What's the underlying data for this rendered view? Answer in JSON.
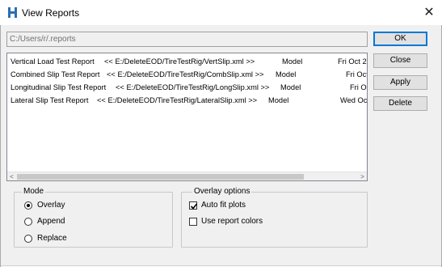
{
  "window": {
    "title": "View Reports",
    "close_glyph": "✕",
    "icon": "h-app-icon"
  },
  "path": {
    "value": "C:/Users/r/.reports"
  },
  "reports": [
    {
      "name": "Vertical Load Test Report",
      "path": "<< E:/DeleteEOD/TireTestRig/VertSlip.xml >>",
      "type": "Model",
      "date": "Fri Oct 29"
    },
    {
      "name": "Combined Slip Test Report",
      "path": "<< E:/DeleteEOD/TireTestRig/CombSlip.xml >>",
      "type": "Model",
      "date": "Fri Oct"
    },
    {
      "name": "Longitudinal Slip Test Report",
      "path": "<< E:/DeleteEOD/TireTestRig/LongSlip.xml >>",
      "type": "Model",
      "date": "Fri O"
    },
    {
      "name": "Lateral Slip Test Report",
      "path": "<< E:/DeleteEOD/TireTestRig/LateralSlip.xml >>",
      "type": "Model",
      "date": "Wed Oc"
    }
  ],
  "scroll": {
    "left_arrow": "<",
    "right_arrow": ">"
  },
  "buttons": {
    "ok": "OK",
    "close": "Close",
    "apply": "Apply",
    "delete": "Delete"
  },
  "mode": {
    "label": "Mode",
    "options": [
      {
        "label": "Overlay",
        "selected": true
      },
      {
        "label": "Append",
        "selected": false
      },
      {
        "label": "Replace",
        "selected": false
      }
    ]
  },
  "overlay_options": {
    "label": "Overlay options",
    "items": [
      {
        "label": "Auto fit plots",
        "checked": true
      },
      {
        "label": "Use report colors",
        "checked": false
      }
    ]
  }
}
